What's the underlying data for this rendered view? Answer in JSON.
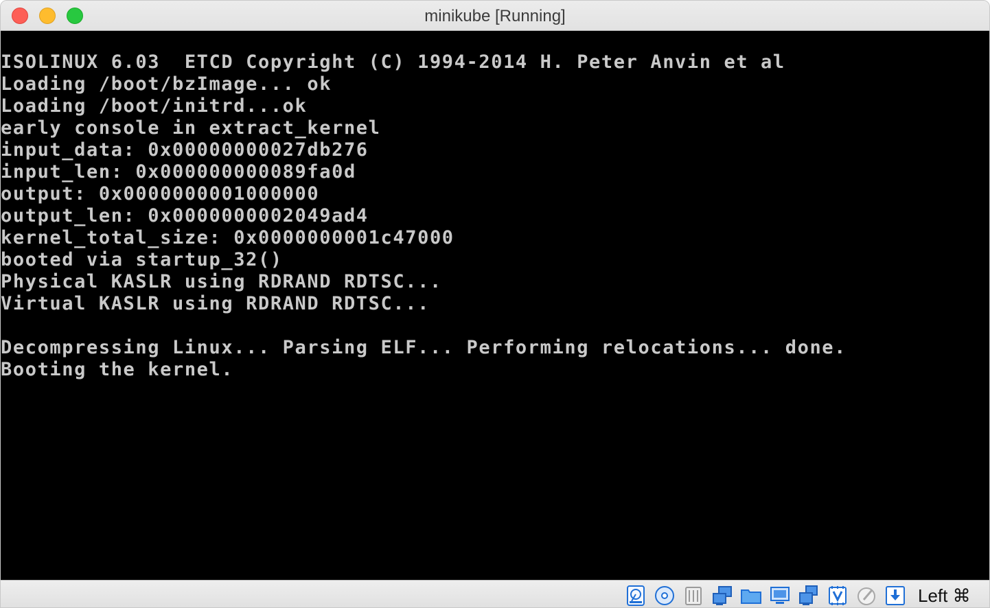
{
  "window": {
    "title": "minikube [Running]"
  },
  "console": {
    "lines": [
      "ISOLINUX 6.03  ETCD Copyright (C) 1994-2014 H. Peter Anvin et al",
      "Loading /boot/bzImage... ok",
      "Loading /boot/initrd...ok",
      "early console in extract_kernel",
      "input_data: 0x00000000027db276",
      "input_len: 0x000000000089fa0d",
      "output: 0x0000000001000000",
      "output_len: 0x0000000002049ad4",
      "kernel_total_size: 0x0000000001c47000",
      "booted via startup_32()",
      "Physical KASLR using RDRAND RDTSC...",
      "Virtual KASLR using RDRAND RDTSC...",
      "",
      "Decompressing Linux... Parsing ELF... Performing relocations... done.",
      "Booting the kernel."
    ],
    "text_color": "#c9c9c9",
    "background": "#000000"
  },
  "statusbar": {
    "icons": [
      "hard-disk-icon",
      "optical-drive-icon",
      "audio-icon",
      "network-icon",
      "shared-folders-icon",
      "display-icon",
      "video-capture-icon",
      "virtualization-icon",
      "mouse-integration-icon",
      "keyboard-capture-icon"
    ],
    "host_key": "Left ⌘",
    "accent_color": "#1f6fd6"
  }
}
